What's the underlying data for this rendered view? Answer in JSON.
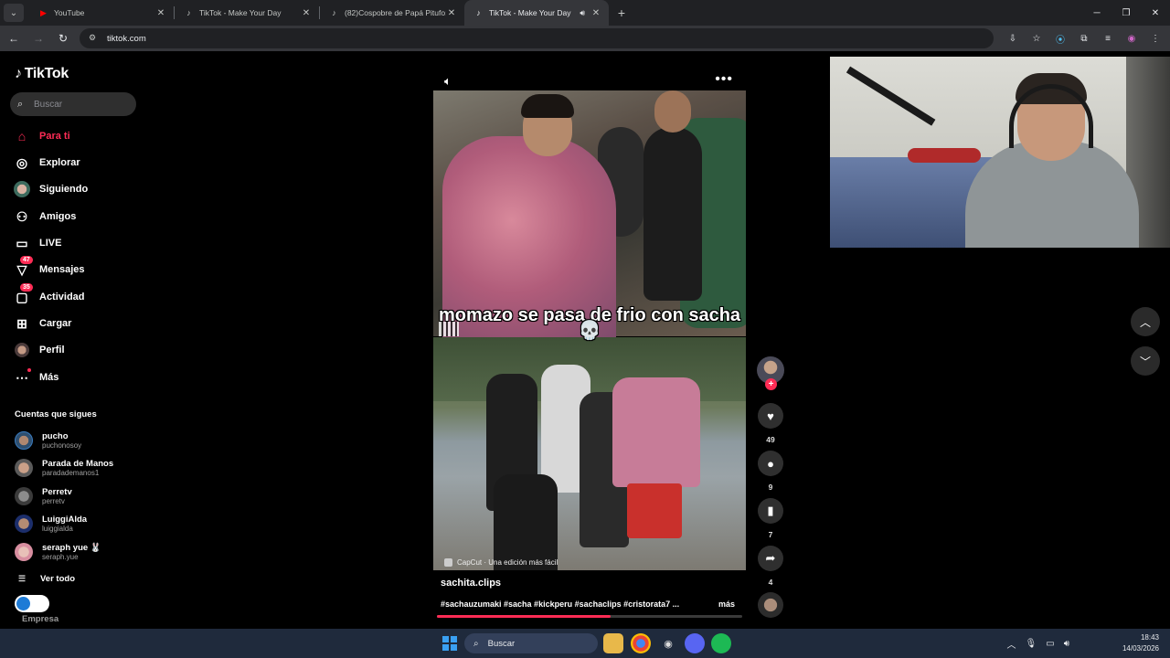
{
  "browser": {
    "tabs": [
      {
        "title": "YouTube",
        "icon": "youtube-icon",
        "active": false
      },
      {
        "title": "TikTok - Make Your Day",
        "icon": "tiktok-icon",
        "active": false
      },
      {
        "title": "(82)Cospobre de Papá Pitufo: M",
        "icon": "tiktok-icon",
        "active": false
      },
      {
        "title": "TikTok - Make Your Day",
        "icon": "tiktok-icon",
        "active": true
      }
    ],
    "url": "tiktok.com"
  },
  "sidebar": {
    "logo": "TikTok",
    "search_placeholder": "Buscar",
    "nav": [
      {
        "label": "Para ti",
        "icon": "home-icon",
        "active": true
      },
      {
        "label": "Explorar",
        "icon": "compass-icon"
      },
      {
        "label": "Siguiendo",
        "icon": "following-avatar-icon"
      },
      {
        "label": "Amigos",
        "icon": "friends-icon"
      },
      {
        "label": "LIVE",
        "icon": "live-icon"
      },
      {
        "label": "Mensajes",
        "icon": "messages-icon",
        "badge": "47"
      },
      {
        "label": "Actividad",
        "icon": "activity-icon",
        "badge": "35"
      },
      {
        "label": "Cargar",
        "icon": "upload-icon"
      },
      {
        "label": "Perfil",
        "icon": "profile-icon"
      },
      {
        "label": "Más",
        "icon": "more-icon"
      }
    ],
    "following_title": "Cuentas que sigues",
    "following": [
      {
        "name": "pucho",
        "handle": "puchonosoy"
      },
      {
        "name": "Parada de Manos",
        "handle": "paradademanos1"
      },
      {
        "name": "Perretv",
        "handle": "perretv"
      },
      {
        "name": "LuiggiAlda",
        "handle": "luiggialda"
      },
      {
        "name": "seraph yue 🐰",
        "handle": "seraph.yue"
      }
    ],
    "see_all": "Ver todo",
    "business": "Empresa"
  },
  "video": {
    "caption_overlay": "momazo se pasa de frio con sacha 💀",
    "capcut_label": "CapCut · Una edición más fácil",
    "author": "sachita.clips",
    "description": "#sachauzumaki #sacha #kickperu #sachaclips #cristorata7 ...",
    "more_label": "más",
    "progress": 0.57
  },
  "actions": {
    "likes": "49",
    "comments": "9",
    "saves": "7",
    "shares": "4"
  },
  "taskbar": {
    "search_placeholder": "Buscar",
    "time": "18:43",
    "date": "14/03/2026"
  }
}
